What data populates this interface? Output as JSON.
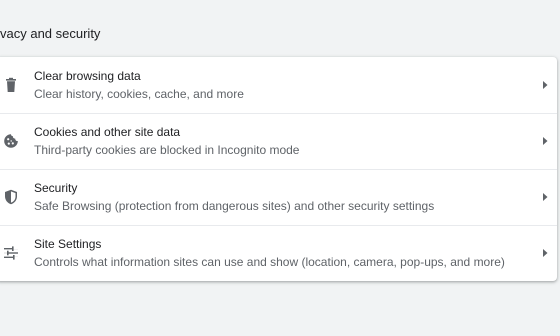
{
  "section": {
    "title": "vacy and security"
  },
  "items": [
    {
      "label": "Clear browsing data",
      "sublabel": "Clear history, cookies, cache, and more",
      "icon": "trash-icon"
    },
    {
      "label": "Cookies and other site data",
      "sublabel": "Third-party cookies are blocked in Incognito mode",
      "icon": "cookie-icon"
    },
    {
      "label": "Security",
      "sublabel": "Safe Browsing (protection from dangerous sites) and other security settings",
      "icon": "shield-icon"
    },
    {
      "label": "Site Settings",
      "sublabel": "Controls what information sites can use and show (location, camera, pop-ups, and more)",
      "icon": "tune-icon"
    }
  ],
  "colors": {
    "background": "#f1f3f4",
    "card": "#ffffff",
    "primary_text": "#202124",
    "secondary_text": "#5f6368",
    "divider": "#e8eaed"
  }
}
